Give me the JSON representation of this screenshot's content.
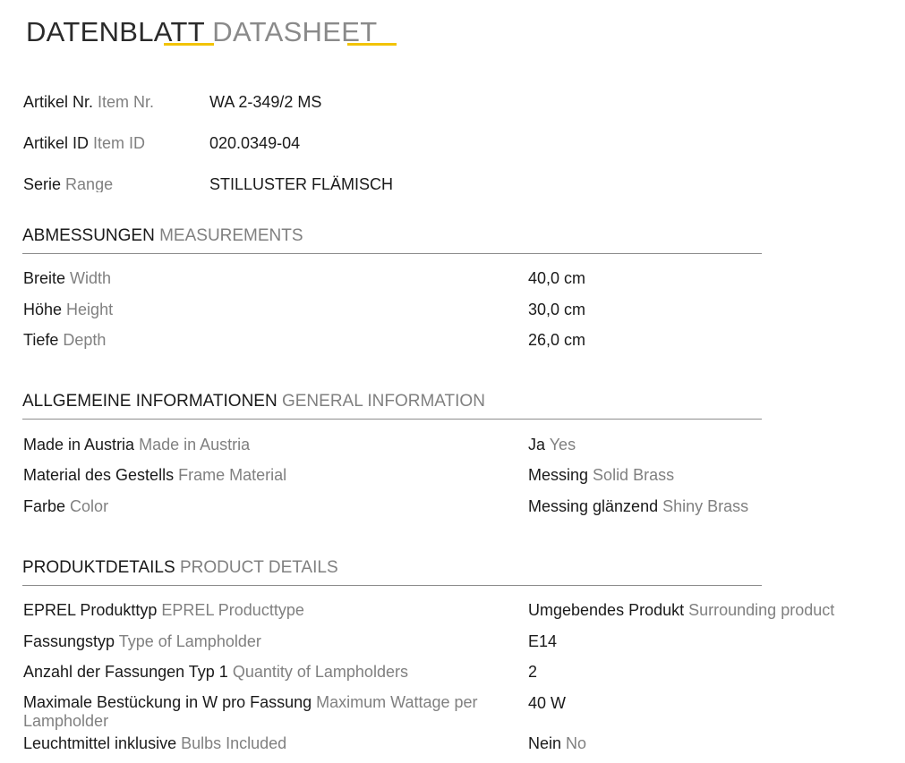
{
  "header": {
    "title_de": "DATENBLATT",
    "title_en": "DATASHEET",
    "accent_color": "#f2c300"
  },
  "item": {
    "nr": {
      "label_de": "Artikel Nr.",
      "label_en": "Item Nr.",
      "value": "WA 2-349/2 MS"
    },
    "id": {
      "label_de": "Artikel ID",
      "label_en": "Item ID",
      "value": "020.0349-04"
    },
    "range": {
      "label_de": "Serie",
      "label_en": "Range",
      "value": "STILLUSTER FLÄMISCH"
    }
  },
  "measurements": {
    "title_de": "ABMESSUNGEN",
    "title_en": "MEASUREMENTS",
    "rows": [
      {
        "label_de": "Breite",
        "label_en": "Width",
        "value": "40,0 cm"
      },
      {
        "label_de": "Höhe",
        "label_en": "Height",
        "value": "30,0 cm"
      },
      {
        "label_de": "Tiefe",
        "label_en": "Depth",
        "value": "26,0 cm"
      }
    ]
  },
  "general": {
    "title_de": "ALLGEMEINE INFORMATIONEN",
    "title_en": "GENERAL INFORMATION",
    "rows": [
      {
        "label_de": "Made in Austria",
        "label_en": "Made in Austria",
        "value_de": "Ja",
        "value_en": "Yes"
      },
      {
        "label_de": "Material des Gestells",
        "label_en": "Frame Material",
        "value_de": "Messing",
        "value_en": "Solid Brass"
      },
      {
        "label_de": "Farbe",
        "label_en": "Color",
        "value_de": "Messing glänzend",
        "value_en": "Shiny Brass"
      }
    ]
  },
  "product": {
    "title_de": "PRODUKTDETAILS",
    "title_en": "PRODUCT DETAILS",
    "rows": [
      {
        "label_de": "EPREL Produkttyp",
        "label_en": "EPREL Producttype",
        "value_de": "Umgebendes Produkt",
        "value_en": "Surrounding product"
      },
      {
        "label_de": "Fassungstyp",
        "label_en": "Type of Lampholder",
        "value_de": "E14",
        "value_en": ""
      },
      {
        "label_de": "Anzahl der Fassungen Typ 1",
        "label_en": "Quantity of Lampholders",
        "value_de": "2",
        "value_en": ""
      },
      {
        "label_de": "Maximale Bestückung in W pro Fassung",
        "label_en": "Maximum Wattage per Lampholder",
        "value_de": "40 W",
        "value_en": ""
      },
      {
        "label_de": "Leuchtmittel inklusive",
        "label_en": "Bulbs Included",
        "value_de": "Nein",
        "value_en": "No"
      }
    ]
  }
}
